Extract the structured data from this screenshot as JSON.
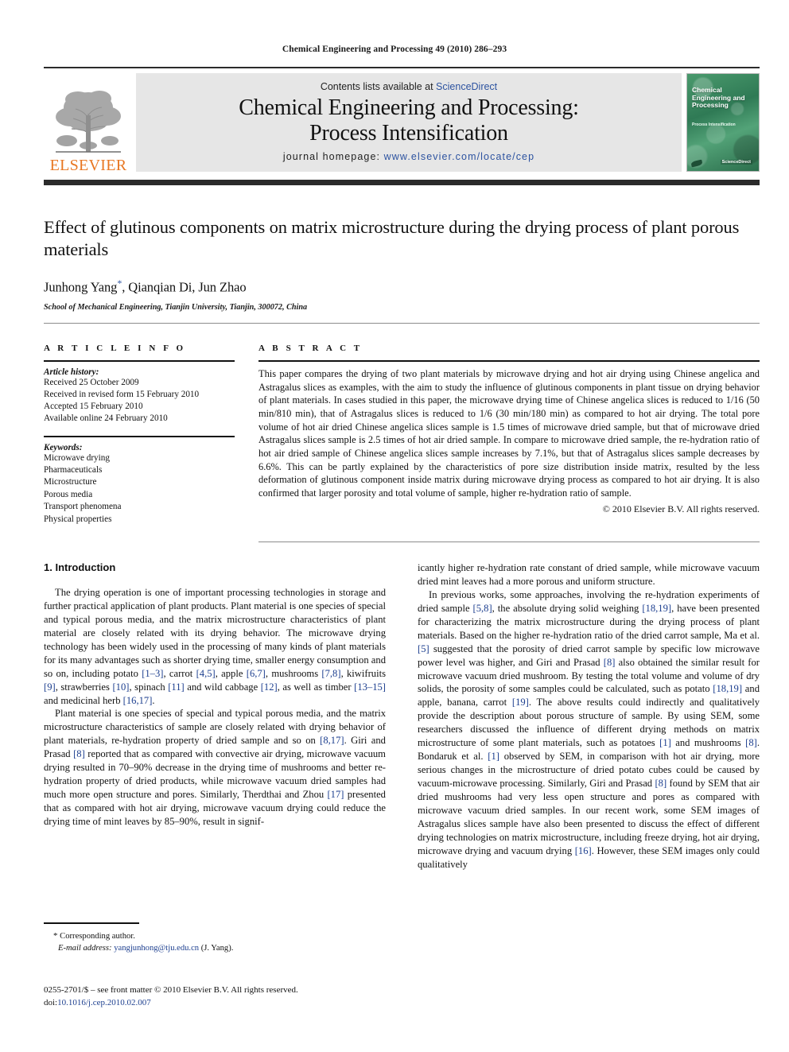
{
  "running_head": "Chemical Engineering and Processing 49 (2010) 286–293",
  "masthead": {
    "publisher_word": "ELSEVIER",
    "contents_prefix": "Contents lists available at ",
    "contents_link": "ScienceDirect",
    "journal_title_line1": "Chemical Engineering and Processing:",
    "journal_title_line2": "Process Intensification",
    "homepage_prefix": "journal homepage: ",
    "homepage_url": "www.elsevier.com/locate/cep",
    "cover": {
      "title": "Chemical Engineering and Processing",
      "subtitle": "Process Intensification",
      "badge": "ScienceDirect"
    },
    "accent_orange": "#E87722",
    "accent_blue": "#2d53a0"
  },
  "article": {
    "title": "Effect of glutinous components on matrix microstructure during the drying process of plant porous materials",
    "authors": "Junhong Yang",
    "authors_rest": ", Qianqian Di, Jun Zhao",
    "corresponding_marker": "*",
    "affiliation": "School of Mechanical Engineering, Tianjin University, Tianjin, 300072, China"
  },
  "info": {
    "heading": "A R T I C L E    I N F O",
    "history_label": "Article history:",
    "history": [
      "Received 25 October 2009",
      "Received in revised form 15 February 2010",
      "Accepted 15 February 2010",
      "Available online 24 February 2010"
    ],
    "keywords_label": "Keywords:",
    "keywords": [
      "Microwave drying",
      "Pharmaceuticals",
      "Microstructure",
      "Porous media",
      "Transport phenomena",
      "Physical properties"
    ]
  },
  "abstract": {
    "heading": "A B S T R A C T",
    "text": "This paper compares the drying of two plant materials by microwave drying and hot air drying using Chinese angelica and Astragalus slices as examples, with the aim to study the influence of glutinous components in plant tissue on drying behavior of plant materials. In cases studied in this paper, the microwave drying time of Chinese angelica slices is reduced to 1/16 (50 min/810 min), that of Astragalus slices is reduced to 1/6 (30 min/180 min) as compared to hot air drying. The total pore volume of hot air dried Chinese angelica slices sample is 1.5 times of microwave dried sample, but that of microwave dried Astragalus slices sample is 2.5 times of hot air dried sample. In compare to microwave dried sample, the re-hydration ratio of hot air dried sample of Chinese angelica slices sample increases by 7.1%, but that of Astragalus slices sample decreases by 6.6%. This can be partly explained by the characteristics of pore size distribution inside matrix, resulted by the less deformation of glutinous component inside matrix during microwave drying process as compared to hot air drying. It is also confirmed that larger porosity and total volume of sample, higher re-hydration ratio of sample.",
    "copyright": "© 2010 Elsevier B.V. All rights reserved."
  },
  "body": {
    "section_heading": "1. Introduction",
    "left_paragraphs": [
      "The drying operation is one of important processing technologies in storage and further practical application of plant products. Plant material is one species of special and typical porous media, and the matrix microstructure characteristics of plant material are closely related with its drying behavior. The microwave drying technology has been widely used in the processing of many kinds of plant materials for its many advantages such as shorter drying time, smaller energy consumption and so on, including potato [1–3], carrot [4,5], apple [6,7], mushrooms [7,8], kiwifruits [9], strawberries [10], spinach [11] and wild cabbage [12], as well as timber [13–15] and medicinal herb [16,17].",
      "Plant material is one species of special and typical porous media, and the matrix microstructure characteristics of sample are closely related with drying behavior of plant materials, re-hydration property of dried sample and so on [8,17]. Giri and Prasad [8] reported that as compared with convective air drying, microwave vacuum drying resulted in 70–90% decrease in the drying time of mushrooms and better re-hydration property of dried products, while microwave vacuum dried samples had much more open structure and pores. Similarly, Therdthai and Zhou [17] presented that as compared with hot air drying, microwave vacuum drying could reduce the drying time of mint leaves by 85–90%, result in signif-"
    ],
    "right_paragraphs": [
      "icantly higher re-hydration rate constant of dried sample, while microwave vacuum dried mint leaves had a more porous and uniform structure.",
      "In previous works, some approaches, involving the re-hydration experiments of dried sample [5,8], the absolute drying solid weighing [18,19], have been presented for characterizing the matrix microstructure during the drying process of plant materials. Based on the higher re-hydration ratio of the dried carrot sample, Ma et al. [5] suggested that the porosity of dried carrot sample by specific low microwave power level was higher, and Giri and Prasad [8] also obtained the similar result for microwave vacuum dried mushroom. By testing the total volume and volume of dry solids, the porosity of some samples could be calculated, such as potato [18,19] and apple, banana, carrot [19]. The above results could indirectly and qualitatively provide the description about porous structure of sample. By using SEM, some researchers discussed the influence of different drying methods on matrix microstructure of some plant materials, such as potatoes [1] and mushrooms [8]. Bondaruk et al. [1] observed by SEM, in comparison with hot air drying, more serious changes in the microstructure of dried potato cubes could be caused by vacuum-microwave processing. Similarly, Giri and Prasad [8] found by SEM that air dried mushrooms had very less open structure and pores as compared with microwave vacuum dried samples. In our recent work, some SEM images of Astragalus slices sample have also been presented to discuss the effect of different drying technologies on matrix microstructure, including freeze drying, hot air drying, microwave drying and vacuum drying [16]. However, these SEM images only could qualitatively"
    ]
  },
  "footnote": {
    "corresponding_marker": "*",
    "corresponding_text": "Corresponding author.",
    "email_label": "E-mail address:",
    "email": "yangjunhong@tju.edu.cn",
    "email_owner": "(J. Yang)."
  },
  "imprint": {
    "line1": "0255-2701/$ – see front matter © 2010 Elsevier B.V. All rights reserved.",
    "doi_label": "doi:",
    "doi_value": "10.1016/j.cep.2010.02.007"
  }
}
